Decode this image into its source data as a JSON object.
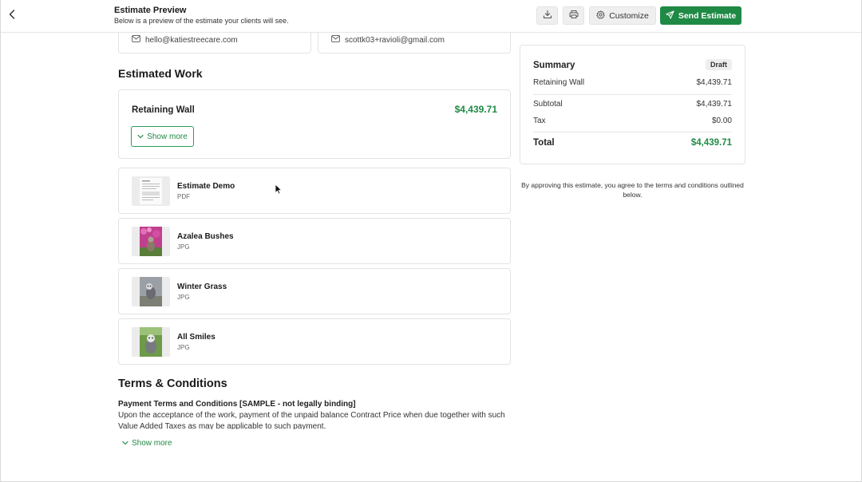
{
  "header": {
    "title": "Estimate Preview",
    "subtitle": "Below is a preview of the estimate your clients will see.",
    "download_icon": "download-icon",
    "print_icon": "printer-icon",
    "customize_label": "Customize",
    "send_label": "Send Estimate",
    "accent_color": "#1f8a45"
  },
  "contacts": {
    "company_email": "hello@katiestreecare.com",
    "client_email": "scottk03+ravioli@gmail.com"
  },
  "estimated_work": {
    "title": "Estimated Work",
    "item_name": "Retaining Wall",
    "item_amount": "$4,439.71",
    "show_more_label": "Show more"
  },
  "attachments": [
    {
      "name": "Estimate Demo",
      "type": "PDF"
    },
    {
      "name": "Azalea Bushes",
      "type": "JPG"
    },
    {
      "name": "Winter Grass",
      "type": "JPG"
    },
    {
      "name": "All Smiles",
      "type": "JPG"
    }
  ],
  "terms": {
    "title": "Terms & Conditions",
    "subtitle": "Payment Terms and Conditions [SAMPLE - not legally binding]",
    "body": "Upon the acceptance of the work, payment of the unpaid balance Contract Price when due together with such Value Added Taxes as may be applicable to such payment.",
    "show_more_label": "Show more"
  },
  "summary": {
    "title": "Summary",
    "status": "Draft",
    "line_item_label": "Retaining Wall",
    "line_item_amount": "$4,439.71",
    "subtotal_label": "Subtotal",
    "subtotal_amount": "$4,439.71",
    "tax_label": "Tax",
    "tax_amount": "$0.00",
    "total_label": "Total",
    "total_amount": "$4,439.71"
  },
  "approval_note": "By approving this estimate, you agree to the terms and conditions outlined below."
}
